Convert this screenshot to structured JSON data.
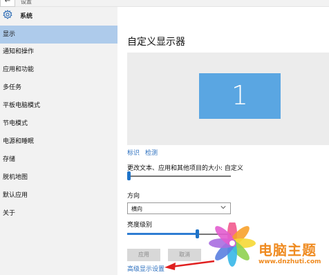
{
  "window": {
    "title": "设置",
    "back_icon": "arrow-left-icon",
    "back_glyph": "←"
  },
  "sidebar": {
    "header": "系统",
    "items": [
      {
        "label": "显示",
        "active": true
      },
      {
        "label": "通知和操作"
      },
      {
        "label": "应用和功能"
      },
      {
        "label": "多任务"
      },
      {
        "label": "平板电脑模式"
      },
      {
        "label": "节电模式"
      },
      {
        "label": "电源和睡眠"
      },
      {
        "label": "存储"
      },
      {
        "label": "脱机地图"
      },
      {
        "label": "默认应用"
      },
      {
        "label": "关于"
      }
    ]
  },
  "main": {
    "title": "自定义显示器",
    "monitor_number": "1",
    "identify_link": "标识",
    "detect_link": "检测",
    "scale_label": "更改文本、应用和其他项目的大小: 自定义",
    "scale_slider_value": 0.0,
    "orientation_label": "方向",
    "orientation_value": "横向",
    "brightness_label": "亮度级别",
    "brightness_value": 0.68,
    "apply_button": "应用",
    "cancel_button": "取消",
    "advanced_link": "高级显示设置"
  },
  "watermark": {
    "title": "电脑主题",
    "url": "www.dnzhuti.com"
  },
  "colors": {
    "accent": "#1e73c8",
    "active_nav": "#aecbeb",
    "monitor": "#5aa6e2",
    "link": "#2a6ebe",
    "annotation_arrow": "#e02020",
    "watermark": "#ef8a1f"
  }
}
